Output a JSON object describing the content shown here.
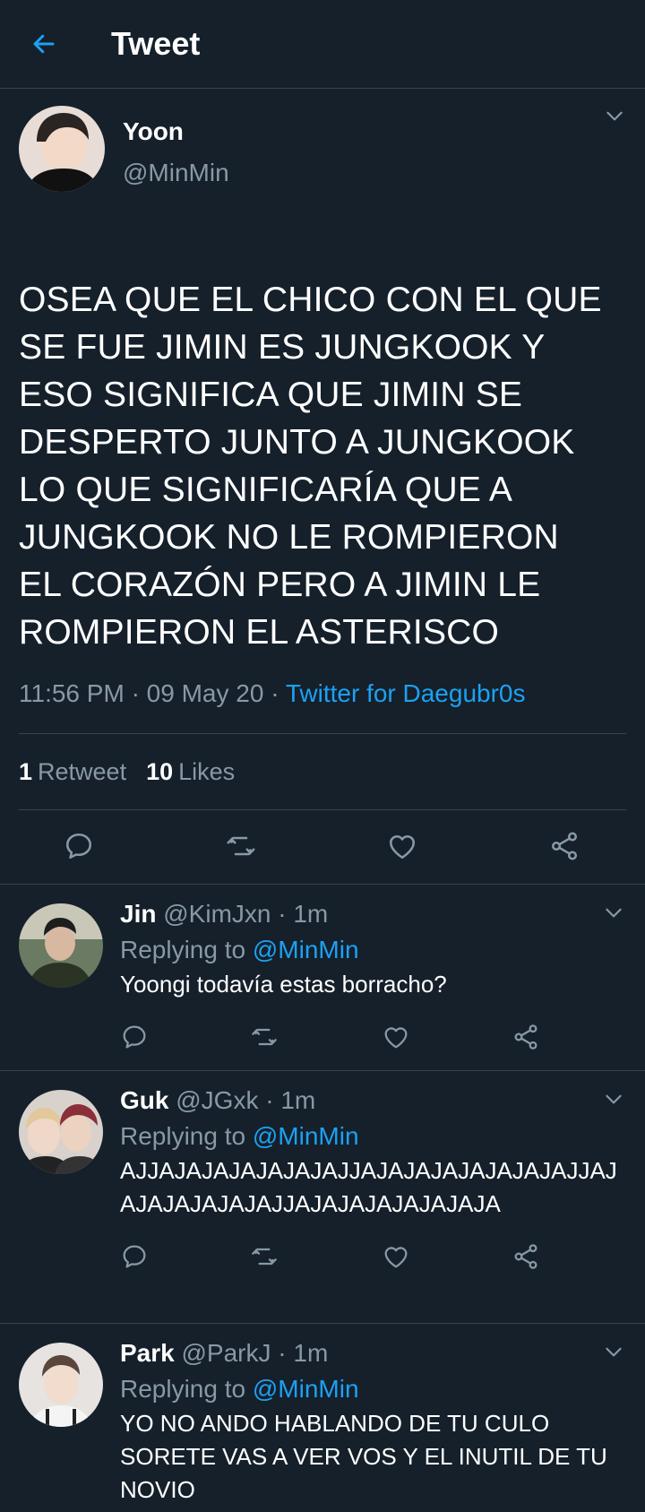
{
  "header": {
    "title": "Tweet"
  },
  "tweet": {
    "name": "Yoon",
    "handle": "@MinMin",
    "text": "OSEA QUE EL CHICO CON EL QUE SE FUE JIMIN ES JUNGKOOK Y ESO SIGNIFICA QUE JIMIN SE DESPERTO JUNTO A JUNGKOOK LO QUE SIGNIFICARÍA QUE A JUNGKOOK NO LE ROMPIERON EL CORAZÓN PERO A JIMIN LE ROMPIERON EL ASTERISCO",
    "time": "11:56 PM",
    "date": "09 May 20",
    "source": "Twitter for Daegubr0s",
    "retweets": "1",
    "retweets_label": "Retweet",
    "likes": "10",
    "likes_label": "Likes"
  },
  "replies": [
    {
      "name": "Jin",
      "handle": "@KimJxn",
      "time": "1m",
      "replying_label": "Replying to",
      "replying_to": "@MinMin",
      "text": "Yoongi todavía estas borracho?"
    },
    {
      "name": "Guk",
      "handle": "@JGxk",
      "time": "1m",
      "replying_label": "Replying to",
      "replying_to": "@MinMin",
      "text": "AJJAJAJAJAJAJAJAJJAJAJAJAJAJAJAJAJJAJAJAJAJAJAJAJJAJAJAJAJAJAJAJA"
    },
    {
      "name": "Park",
      "handle": "@ParkJ",
      "time": "1m",
      "replying_label": "Replying to",
      "replying_to": "@MinMin",
      "text": "YO NO ANDO HABLANDO DE TU CULO SORETE VAS A VER VOS Y EL INUTIL DE TU NOVIO"
    }
  ],
  "colors": {
    "background": "#15202b",
    "accent": "#1da1f2",
    "muted": "#8899a6",
    "divider": "#38444d"
  },
  "icons": [
    "back-arrow-icon",
    "chevron-down-icon",
    "reply-icon",
    "retweet-icon",
    "like-icon",
    "share-icon"
  ]
}
